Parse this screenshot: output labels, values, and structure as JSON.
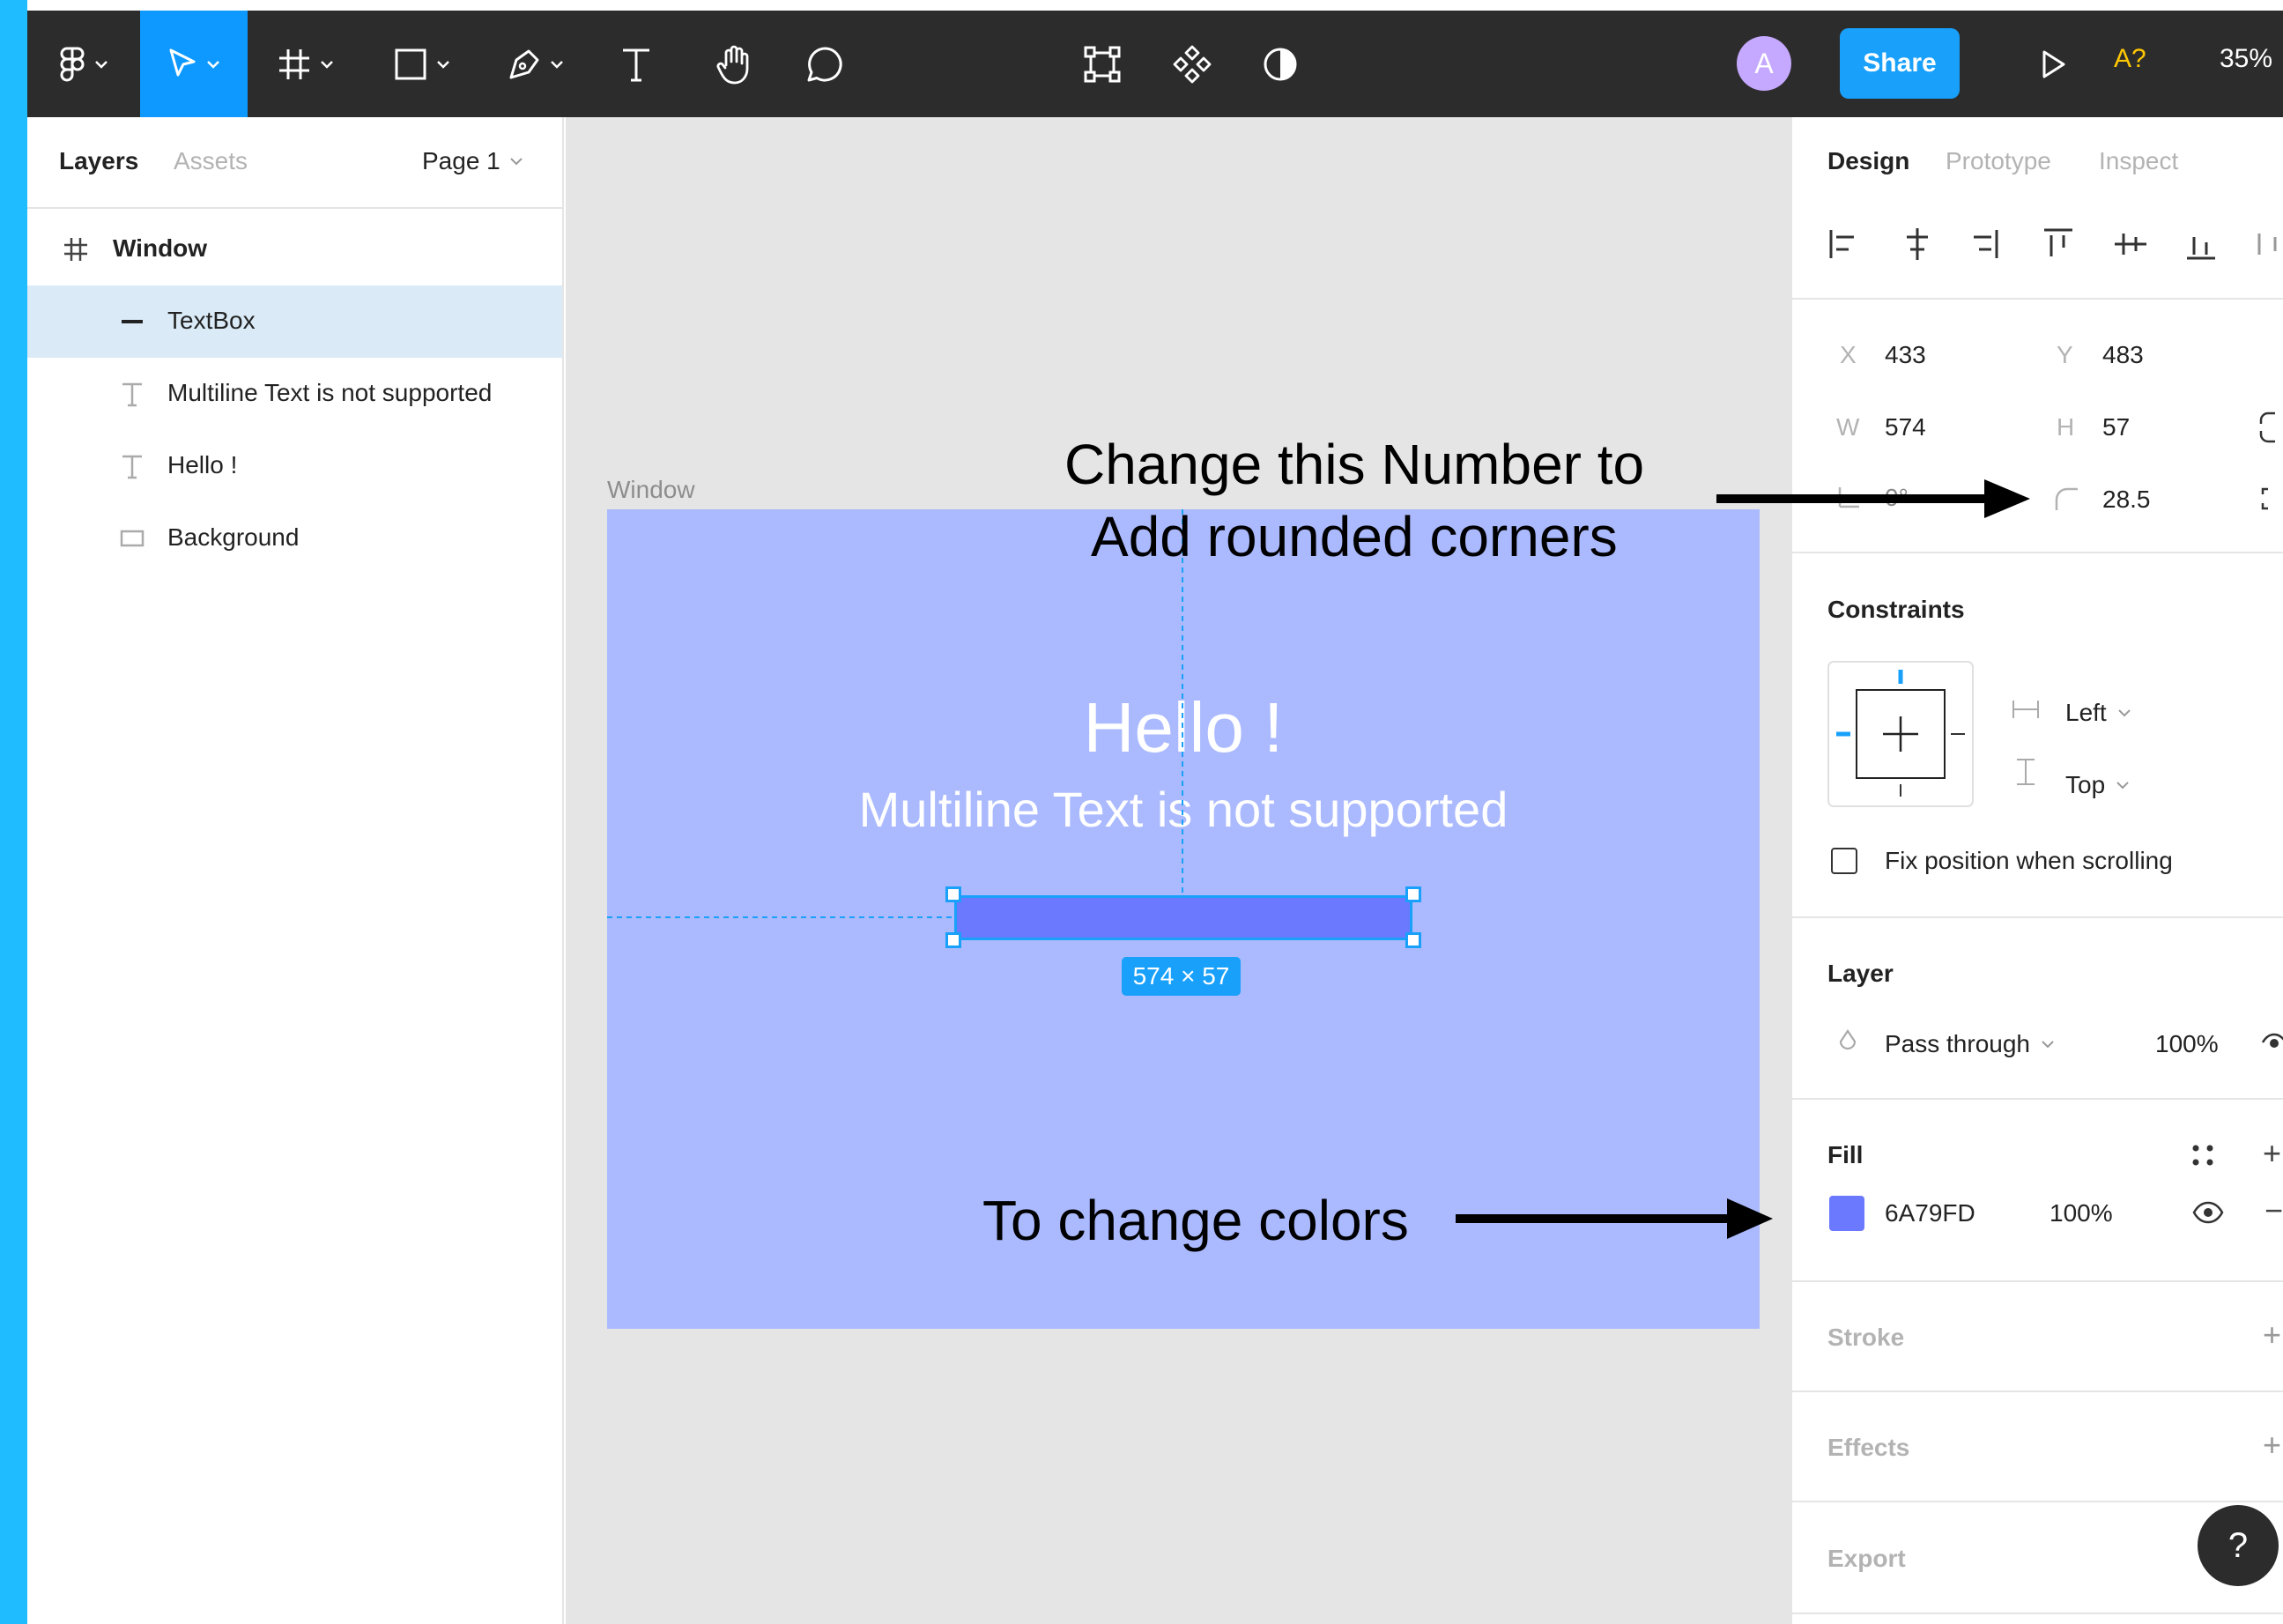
{
  "toolbar": {
    "share_label": "Share",
    "avatar_letter": "A",
    "a11y_label": "A?",
    "zoom": "35%"
  },
  "layers_panel": {
    "tabs": [
      "Layers",
      "Assets"
    ],
    "page": "Page 1",
    "layers": [
      {
        "name": "Window",
        "icon": "frame-icon"
      },
      {
        "name": "TextBox",
        "icon": "line-icon"
      },
      {
        "name": "Multiline Text is not supported",
        "icon": "text-icon"
      },
      {
        "name": "Hello !",
        "icon": "text-icon"
      },
      {
        "name": "Background",
        "icon": "rectangle-icon"
      }
    ]
  },
  "canvas": {
    "frame_label": "Window",
    "hello_text": "Hello !",
    "subtext": "Multiline Text is not supported",
    "size_badge": "574 × 57",
    "annotation_corners_line1": "Change this Number to",
    "annotation_corners_line2": "Add rounded corners",
    "annotation_colors": "To change colors",
    "frame_color": "#abbaff",
    "textbox_color": "#6a79fd"
  },
  "design_panel": {
    "tabs": [
      "Design",
      "Prototype",
      "Inspect"
    ],
    "x_label": "X",
    "x_value": "433",
    "y_label": "Y",
    "y_value": "483",
    "w_label": "W",
    "w_value": "574",
    "h_label": "H",
    "h_value": "57",
    "rotation_value": "0°",
    "radius_value": "28.5",
    "constraints_title": "Constraints",
    "constraint_h": "Left",
    "constraint_v": "Top",
    "fix_position_label": "Fix position when scrolling",
    "layer_title": "Layer",
    "blend_mode": "Pass through",
    "layer_opacity": "100%",
    "fill_title": "Fill",
    "fill_hex": "6A79FD",
    "fill_opacity": "100%",
    "stroke_title": "Stroke",
    "effects_title": "Effects",
    "export_title": "Export"
  },
  "help_label": "?",
  "colors": {
    "accent": "#18a0fb",
    "toolbar_bg": "#2c2c2c",
    "left_edge": "#1fbcff"
  }
}
